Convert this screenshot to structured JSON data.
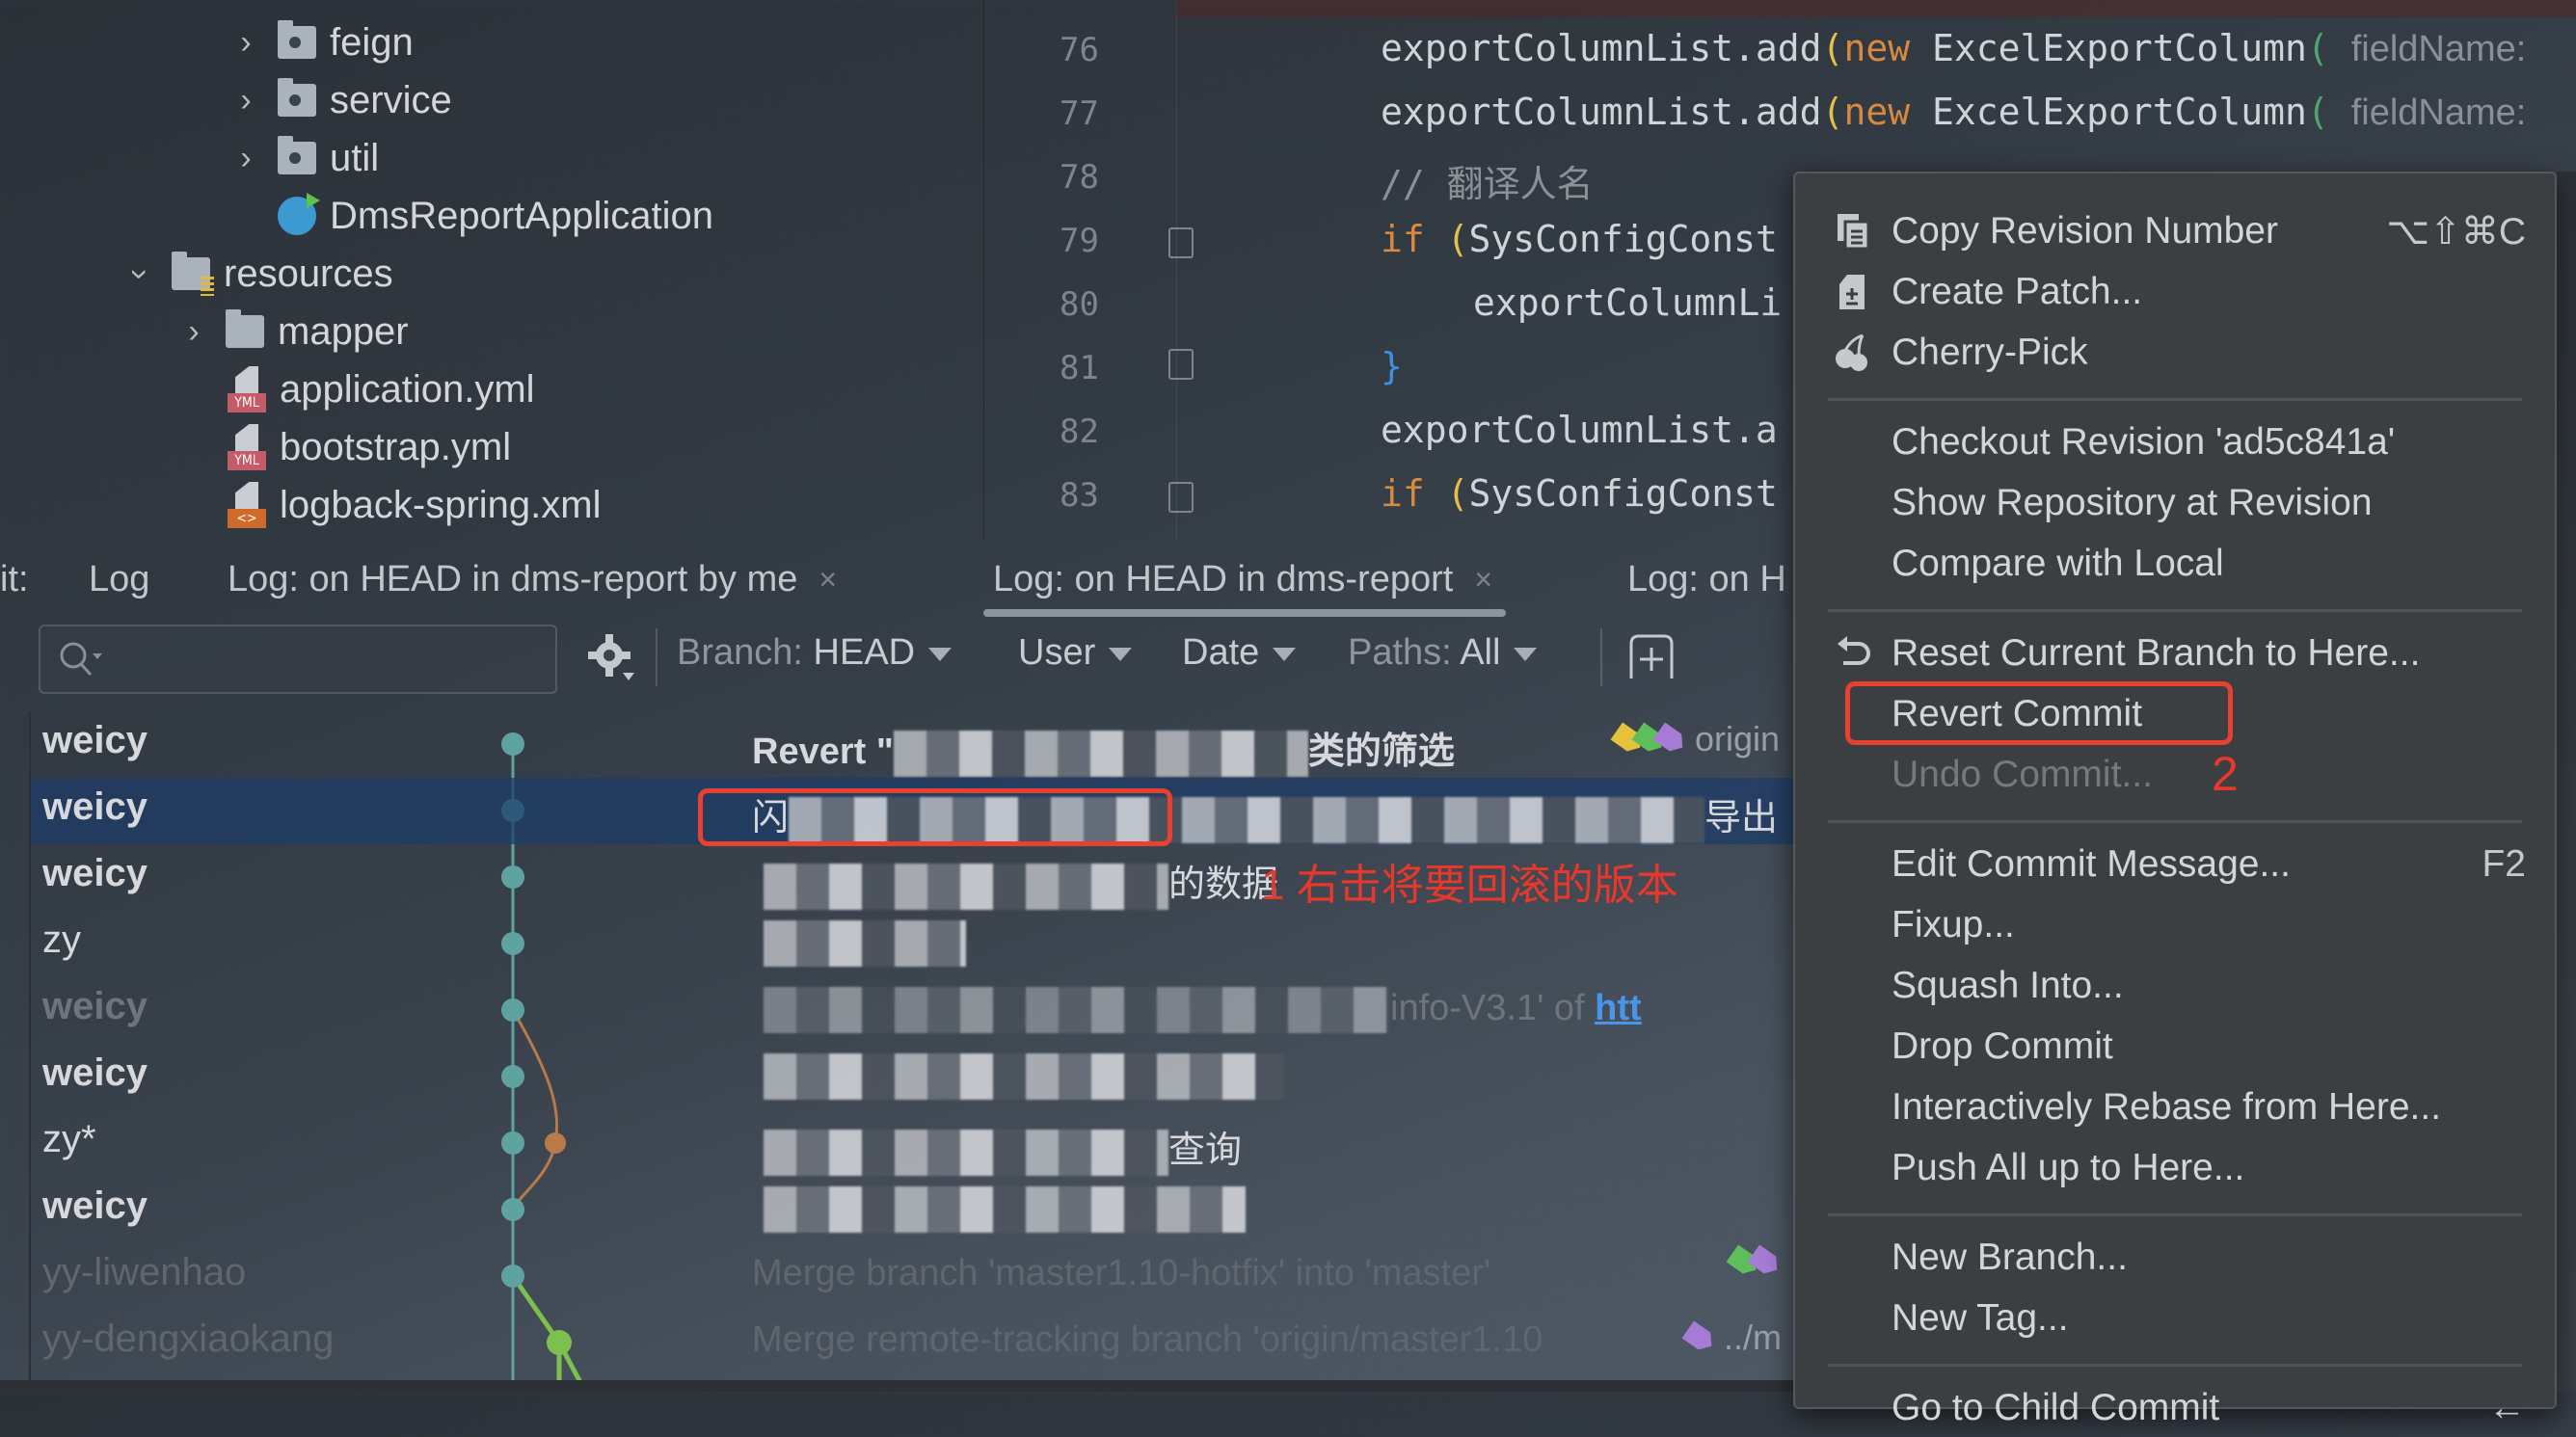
{
  "project_tree": {
    "items": [
      {
        "label": "feign",
        "type": "package",
        "expanded": false
      },
      {
        "label": "service",
        "type": "package",
        "expanded": false
      },
      {
        "label": "util",
        "type": "package",
        "expanded": false
      },
      {
        "label": "DmsReportApplication",
        "type": "spring-boot-class"
      },
      {
        "label": "resources",
        "type": "resources-folder",
        "expanded": true
      },
      {
        "label": "mapper",
        "type": "folder",
        "expanded": false
      },
      {
        "label": "application.yml",
        "type": "yml",
        "badge": "YML"
      },
      {
        "label": "bootstrap.yml",
        "type": "yml",
        "badge": "YML"
      },
      {
        "label": "logback-spring.xml",
        "type": "xml",
        "badge": "<>"
      }
    ]
  },
  "editor": {
    "lines": [
      {
        "num": "76",
        "text": "exportColumnList.add(new ExcelExportColumn( fieldName:"
      },
      {
        "num": "77",
        "text": "exportColumnList.add(new ExcelExportColumn( fieldName:"
      },
      {
        "num": "78",
        "text": "// 翻译人名"
      },
      {
        "num": "79",
        "text": "if (SysConfigConst"
      },
      {
        "num": "80",
        "text": "    exportColumnLi"
      },
      {
        "num": "81",
        "text": "}"
      },
      {
        "num": "82",
        "text": "exportColumnList.a"
      },
      {
        "num": "83",
        "text": "if (SysConfigConst"
      }
    ],
    "tokens": {
      "obj": "exportColumnList.add",
      "new_kw": "new",
      "cls": "ExcelExportColumn",
      "param_hint": "fieldName:",
      "comment": "// 翻译人名",
      "if_kw": "if",
      "cond": "SysConfigConst",
      "inner": "exportColumnLi",
      "close": "}",
      "trunc82": "exportColumnList.a"
    }
  },
  "log_panel": {
    "prefix": "it:",
    "tabs": [
      {
        "label": "Log",
        "closable": false,
        "active": false
      },
      {
        "label": "Log: on HEAD in dms-report by me",
        "closable": true,
        "active": false
      },
      {
        "label": "Log: on HEAD in dms-report",
        "closable": true,
        "active": true
      },
      {
        "label": "Log: on H",
        "closable": false,
        "active": false
      }
    ],
    "close_glyph": "×",
    "toolbar": {
      "search_placeholder": "",
      "branch_label": "Branch:",
      "branch_value": "HEAD",
      "user_label": "User",
      "date_label": "Date",
      "paths_label": "Paths:",
      "paths_value": "All"
    },
    "commits": [
      {
        "author": "weicy",
        "message_prefix": "Revert \"",
        "message_suffix": "类的筛选",
        "refs": "origin",
        "style": "bold"
      },
      {
        "author": "weicy",
        "message_prefix": "闪",
        "message_suffix": "导出",
        "selected": true,
        "style": "normal"
      },
      {
        "author": "weicy",
        "message_prefix": "",
        "message_suffix": "的数据",
        "style": "normal"
      },
      {
        "author": "zy",
        "message_prefix": "",
        "message_suffix": "",
        "style": "thin"
      },
      {
        "author": "weicy",
        "message_prefix": "",
        "message_suffix": "info-V3.1' of",
        "link": "htt",
        "style": "dim"
      },
      {
        "author": "weicy",
        "message_prefix": "",
        "message_suffix": "",
        "style": "normal"
      },
      {
        "author": "zy*",
        "message_prefix": "",
        "message_suffix": "查询",
        "style": "thin"
      },
      {
        "author": "weicy",
        "message_prefix": "",
        "message_suffix": "",
        "style": "normal"
      },
      {
        "author": "yy-liwenhao",
        "message_prefix": "Merge branch 'master1.10-hotfix' into 'master'",
        "message_suffix": "",
        "style": "faint"
      },
      {
        "author": "yy-dengxiaokang",
        "message_prefix": "Merge remote-tracking branch 'origin/master1.10",
        "message_suffix": "",
        "refs": "../m",
        "style": "faint"
      }
    ],
    "annotation_1": "1 右击将要回滚的版本",
    "annotation_2": "2"
  },
  "context_menu": {
    "items": [
      {
        "label": "Copy Revision Number",
        "shortcut": "⌥⇧⌘C",
        "icon": "copy-icon"
      },
      {
        "label": "Create Patch...",
        "icon": "patch-icon"
      },
      {
        "label": "Cherry-Pick",
        "icon": "cherry-icon"
      },
      {
        "separator": true
      },
      {
        "label": "Checkout Revision 'ad5c841a'"
      },
      {
        "label": "Show Repository at Revision"
      },
      {
        "label": "Compare with Local"
      },
      {
        "separator": true
      },
      {
        "label": "Reset Current Branch to Here...",
        "icon": "reset-icon"
      },
      {
        "label": "Revert Commit",
        "highlighted": true
      },
      {
        "label": "Undo Commit...",
        "disabled": true
      },
      {
        "separator": true
      },
      {
        "label": "Edit Commit Message...",
        "shortcut": "F2"
      },
      {
        "label": "Fixup..."
      },
      {
        "label": "Squash Into..."
      },
      {
        "label": "Drop Commit"
      },
      {
        "label": "Interactively Rebase from Here..."
      },
      {
        "label": "Push All up to Here..."
      },
      {
        "separator": true
      },
      {
        "label": "New Branch..."
      },
      {
        "label": "New Tag..."
      },
      {
        "separator": true
      },
      {
        "label": "Go to Child Commit",
        "shortcut": "←"
      }
    ]
  },
  "colors": {
    "annotation_red": "#e8382b",
    "graph_main": "#5fa3a0",
    "graph_orange": "#b87a48",
    "graph_green": "#7cc04f",
    "link_blue": "#4a95e8",
    "selection": "#1c3c69",
    "menu_bg": "#3c3f41"
  }
}
